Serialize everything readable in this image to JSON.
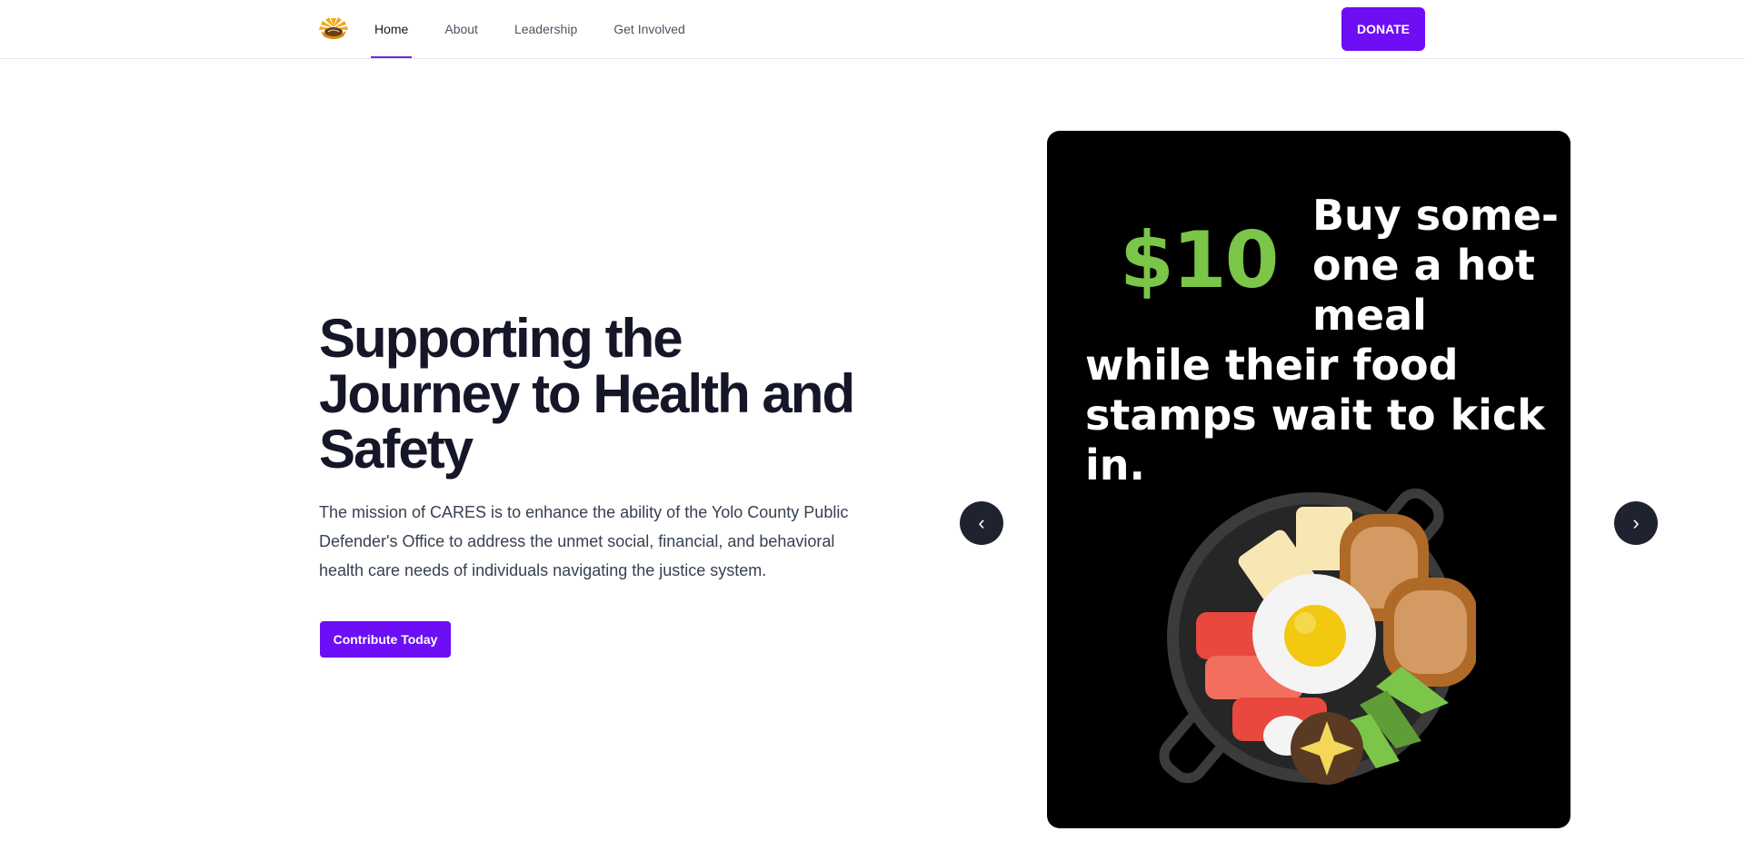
{
  "header": {
    "nav": [
      {
        "label": "Home",
        "active": true
      },
      {
        "label": "About"
      },
      {
        "label": "Leadership"
      },
      {
        "label": "Get Involved"
      }
    ],
    "donate_label": "DONATE"
  },
  "hero": {
    "title": "Supporting the Journey to Health and Safety",
    "description": "The mission of CARES is to enhance the ability of the Yolo County Public Defender's Office to address the unmet social, financial, and behavioral health care needs of individuals navigating the justice system.",
    "cta_label": "Contribute Today"
  },
  "carousel": {
    "prev_icon": "‹",
    "next_icon": "›",
    "slide": {
      "price": "$10",
      "headline": "Buy some-one a hot meal",
      "subline": "while their food stamps wait to kick in.",
      "image": "breakfast-skillet-illustration"
    }
  },
  "colors": {
    "brand": "#6d0ef5",
    "price_green": "#7bc548",
    "slide_bg": "#000000",
    "arrow_bg": "#1f2330"
  }
}
